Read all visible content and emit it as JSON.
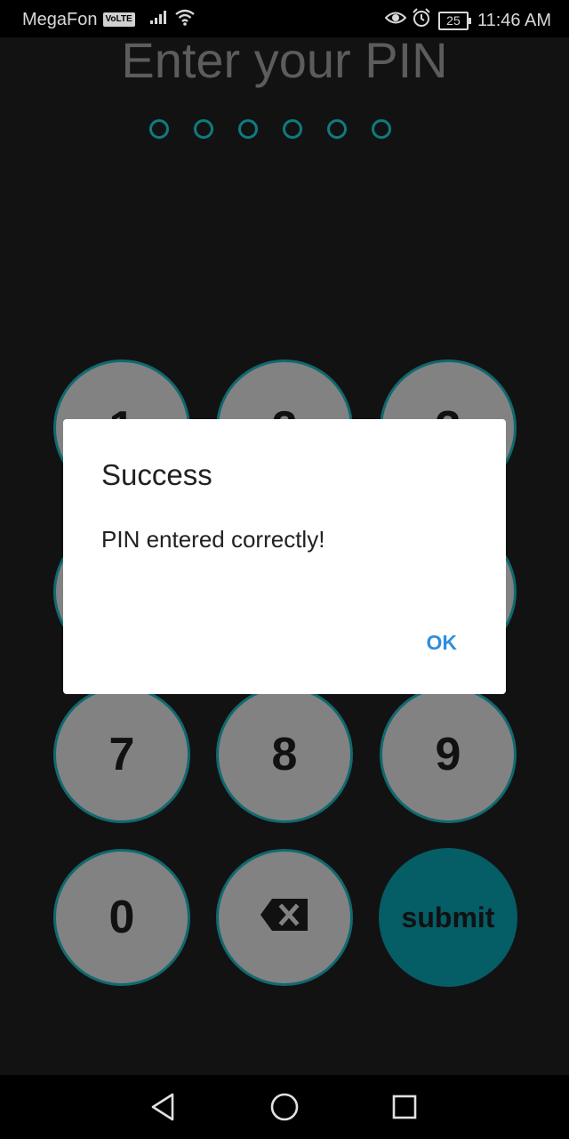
{
  "status_bar": {
    "carrier": "MegaFon",
    "volte": "VoLTE",
    "battery": "25",
    "time": "11:46 AM",
    "icons": [
      "signal-icon",
      "wifi-icon",
      "eye-icon",
      "alarm-icon",
      "battery-icon"
    ]
  },
  "screen": {
    "title": "Enter your PIN",
    "pin_dots": 6
  },
  "keypad": {
    "k1": "1",
    "k2": "2",
    "k3": "3",
    "k7": "7",
    "k8": "8",
    "k9": "9",
    "k0": "0",
    "backspace_icon": "backspace-icon",
    "submit": "submit"
  },
  "dialog": {
    "title": "Success",
    "message": "PIN entered correctly!",
    "ok": "OK"
  },
  "nav_bar": {
    "icons": [
      "back-icon",
      "home-icon",
      "recents-icon"
    ]
  },
  "colors": {
    "accent": "#0f7b81",
    "key_fill": "#828282",
    "submit_fill": "#055d66",
    "dialog_button": "#2f8fde",
    "background": "#121212"
  }
}
